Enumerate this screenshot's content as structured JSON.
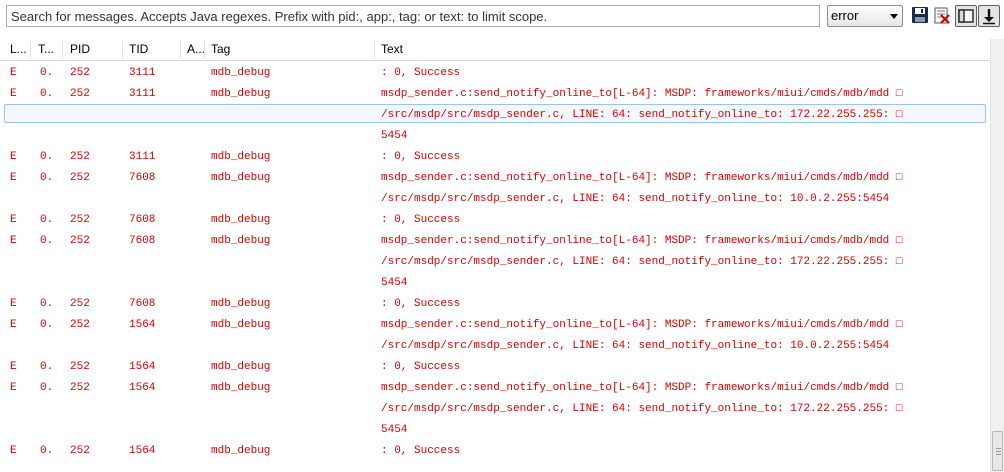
{
  "toolbar": {
    "search_placeholder": "Search for messages. Accepts Java regexes. Prefix with pid:, app:, tag: or text: to limit scope.",
    "level_value": "error",
    "icons": [
      "save-icon",
      "clear-log-icon",
      "show-filters-icon",
      "scroll-lock-icon"
    ]
  },
  "columns": [
    {
      "label": "L..."
    },
    {
      "label": "T..."
    },
    {
      "label": "PID"
    },
    {
      "label": "TID"
    },
    {
      "label": "A..."
    },
    {
      "label": "Tag"
    },
    {
      "label": "Text"
    }
  ],
  "colors": {
    "error_text": "#d60000",
    "selection_border": "#9fc3e4"
  },
  "rows": [
    {
      "level": "E",
      "time": "0.",
      "pid": "252",
      "tid": "3111",
      "app": "",
      "tag": "mdb_debug",
      "text": ": 0, Success"
    },
    {
      "level": "E",
      "time": "0.",
      "pid": "252",
      "tid": "3111",
      "app": "",
      "tag": "mdb_debug",
      "text": "msdp_sender.c:send_notify_online_to[L-64]: MSDP: frameworks/miui/cmds/mdb/mdd □"
    },
    {
      "level": "",
      "time": "",
      "pid": "",
      "tid": "",
      "app": "",
      "tag": "",
      "text": "/src/msdp/src/msdp_sender.c, LINE: 64: send_notify_online_to: 172.22.255.255: □"
    },
    {
      "level": "",
      "time": "",
      "pid": "",
      "tid": "",
      "app": "",
      "tag": "",
      "text": "5454"
    },
    {
      "level": "E",
      "time": "0.",
      "pid": "252",
      "tid": "3111",
      "app": "",
      "tag": "mdb_debug",
      "text": ": 0, Success"
    },
    {
      "level": "E",
      "time": "0.",
      "pid": "252",
      "tid": "7608",
      "app": "",
      "tag": "mdb_debug",
      "text": "msdp_sender.c:send_notify_online_to[L-64]: MSDP: frameworks/miui/cmds/mdb/mdd □"
    },
    {
      "level": "",
      "time": "",
      "pid": "",
      "tid": "",
      "app": "",
      "tag": "",
      "text": "/src/msdp/src/msdp_sender.c, LINE: 64: send_notify_online_to: 10.0.2.255:5454"
    },
    {
      "level": "E",
      "time": "0.",
      "pid": "252",
      "tid": "7608",
      "app": "",
      "tag": "mdb_debug",
      "text": ": 0, Success"
    },
    {
      "level": "E",
      "time": "0.",
      "pid": "252",
      "tid": "7608",
      "app": "",
      "tag": "mdb_debug",
      "text": "msdp_sender.c:send_notify_online_to[L-64]: MSDP: frameworks/miui/cmds/mdb/mdd □"
    },
    {
      "level": "",
      "time": "",
      "pid": "",
      "tid": "",
      "app": "",
      "tag": "",
      "text": "/src/msdp/src/msdp_sender.c, LINE: 64: send_notify_online_to: 172.22.255.255: □"
    },
    {
      "level": "",
      "time": "",
      "pid": "",
      "tid": "",
      "app": "",
      "tag": "",
      "text": "5454"
    },
    {
      "level": "E",
      "time": "0.",
      "pid": "252",
      "tid": "7608",
      "app": "",
      "tag": "mdb_debug",
      "text": ": 0, Success"
    },
    {
      "level": "E",
      "time": "0.",
      "pid": "252",
      "tid": "1564",
      "app": "",
      "tag": "mdb_debug",
      "text": "msdp_sender.c:send_notify_online_to[L-64]: MSDP: frameworks/miui/cmds/mdb/mdd □"
    },
    {
      "level": "",
      "time": "",
      "pid": "",
      "tid": "",
      "app": "",
      "tag": "",
      "text": "/src/msdp/src/msdp_sender.c, LINE: 64: send_notify_online_to: 10.0.2.255:5454"
    },
    {
      "level": "E",
      "time": "0.",
      "pid": "252",
      "tid": "1564",
      "app": "",
      "tag": "mdb_debug",
      "text": ": 0, Success"
    },
    {
      "level": "E",
      "time": "0.",
      "pid": "252",
      "tid": "1564",
      "app": "",
      "tag": "mdb_debug",
      "text": "msdp_sender.c:send_notify_online_to[L-64]: MSDP: frameworks/miui/cmds/mdb/mdd □"
    },
    {
      "level": "",
      "time": "",
      "pid": "",
      "tid": "",
      "app": "",
      "tag": "",
      "text": "/src/msdp/src/msdp_sender.c, LINE: 64: send_notify_online_to: 172.22.255.255: □"
    },
    {
      "level": "",
      "time": "",
      "pid": "",
      "tid": "",
      "app": "",
      "tag": "",
      "text": "5454"
    },
    {
      "level": "E",
      "time": "0.",
      "pid": "252",
      "tid": "1564",
      "app": "",
      "tag": "mdb_debug",
      "text": ": 0, Success"
    }
  ]
}
